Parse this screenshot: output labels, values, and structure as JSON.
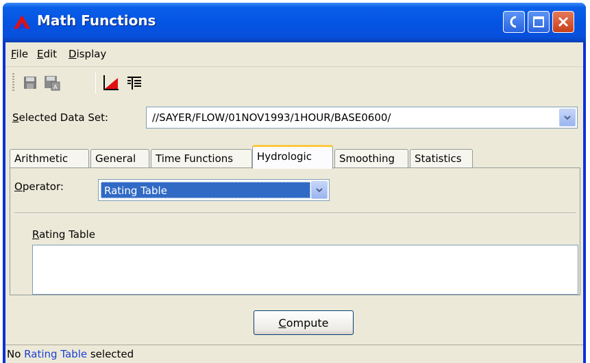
{
  "window": {
    "title": "Math Functions",
    "colors": {
      "titlebar": "#0454e3",
      "client": "#ece9d8",
      "selection": "#316ac5",
      "tab_highlight": "#ffc83c"
    }
  },
  "menu": {
    "items": [
      {
        "mnemonic": "F",
        "rest": "ile"
      },
      {
        "mnemonic": "E",
        "rest": "dit"
      },
      {
        "mnemonic": "D",
        "rest": "isplay"
      }
    ]
  },
  "toolbar": {
    "icons": [
      "save-icon",
      "save-as-icon",
      "plot-icon",
      "tabulate-icon"
    ]
  },
  "dataset": {
    "label_mnemonic": "S",
    "label_rest": "elected Data Set:",
    "value": "//SAYER/FLOW/01NOV1993/1HOUR/BASE0600/"
  },
  "tabs": [
    {
      "label": "Arithmetic"
    },
    {
      "label": "General"
    },
    {
      "label": "Time Functions"
    },
    {
      "label": "Hydrologic",
      "active": true
    },
    {
      "label": "Smoothing"
    },
    {
      "label": "Statistics"
    }
  ],
  "panel": {
    "operator_label_mnemonic": "O",
    "operator_label_rest": "perator:",
    "operator_value": "Rating Table",
    "rating_label_mnemonic": "R",
    "rating_label_rest": "ating Table"
  },
  "compute": {
    "mnemonic": "C",
    "rest": "ompute"
  },
  "status": {
    "prefix": "No ",
    "link": "Rating Table",
    "suffix": " selected"
  }
}
